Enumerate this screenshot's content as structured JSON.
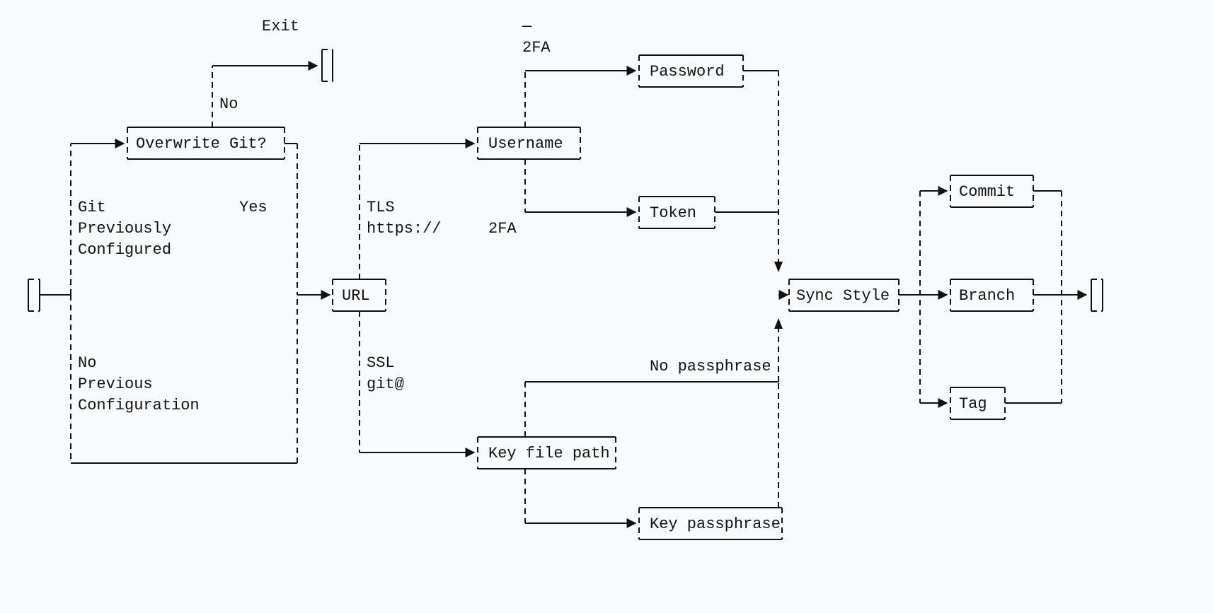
{
  "nodes": {
    "overwrite_git": "Overwrite Git?",
    "url": "URL",
    "username": "Username",
    "password": "Password",
    "token": "Token",
    "key_file_path": "Key file path",
    "key_passphrase": "Key passphrase",
    "sync_style": "Sync Style",
    "commit": "Commit",
    "branch": "Branch",
    "tag": "Tag"
  },
  "edge_labels": {
    "exit": "Exit",
    "no": "No",
    "yes": "Yes",
    "git_prev_configured_1": "Git",
    "git_prev_configured_2": "Previously",
    "git_prev_configured_3": "Configured",
    "no_prev_config_1": "No",
    "no_prev_config_2": "Previous",
    "no_prev_config_3": "Configuration",
    "tls_1": "TLS",
    "tls_2": "https://",
    "ssl_1": "SSL",
    "ssl_2": "git@",
    "two_fa_bar": "—",
    "two_fa_not": "2FA",
    "two_fa_yes": "2FA",
    "no_passphrase": "No passphrase"
  }
}
